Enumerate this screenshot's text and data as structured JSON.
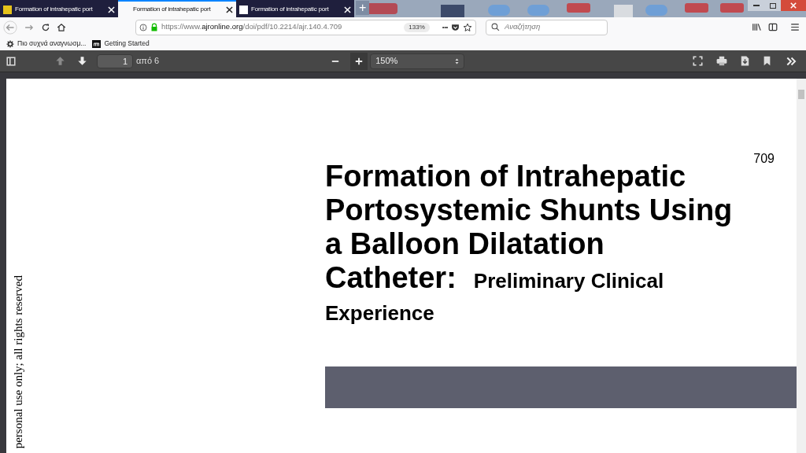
{
  "tabs": [
    {
      "title": "Formation of intrahepatic port",
      "selected": false
    },
    {
      "title": "Formation of intrahepatic port",
      "selected": true
    },
    {
      "title": "Formation of intrahepatic port",
      "selected": false
    }
  ],
  "new_tab": "+",
  "address_bar": {
    "scheme": "https://www.",
    "domain": "ajronline.org",
    "path": "/doi/pdf/10.2214/ajr.140.4.709",
    "zoom": "133%",
    "more": "•••"
  },
  "search": {
    "placeholder": "Αναζήτηση"
  },
  "bookmarks": [
    {
      "label": "Πιο συχνά αναγνωσμ..."
    },
    {
      "label": "Getting Started"
    }
  ],
  "pdf_toolbar": {
    "page": "1",
    "page_count": "από 6",
    "zoom": "150%"
  },
  "document": {
    "page_number": "709",
    "title_lines": [
      "Formation of Intrahepatic",
      "Portosystemic Shunts Using",
      "a Balloon Dilatation",
      "Catheter:"
    ],
    "subtitle_lines": [
      "Preliminary Clinical",
      "Experience"
    ],
    "side_note": "personal use only; all rights reserved"
  }
}
